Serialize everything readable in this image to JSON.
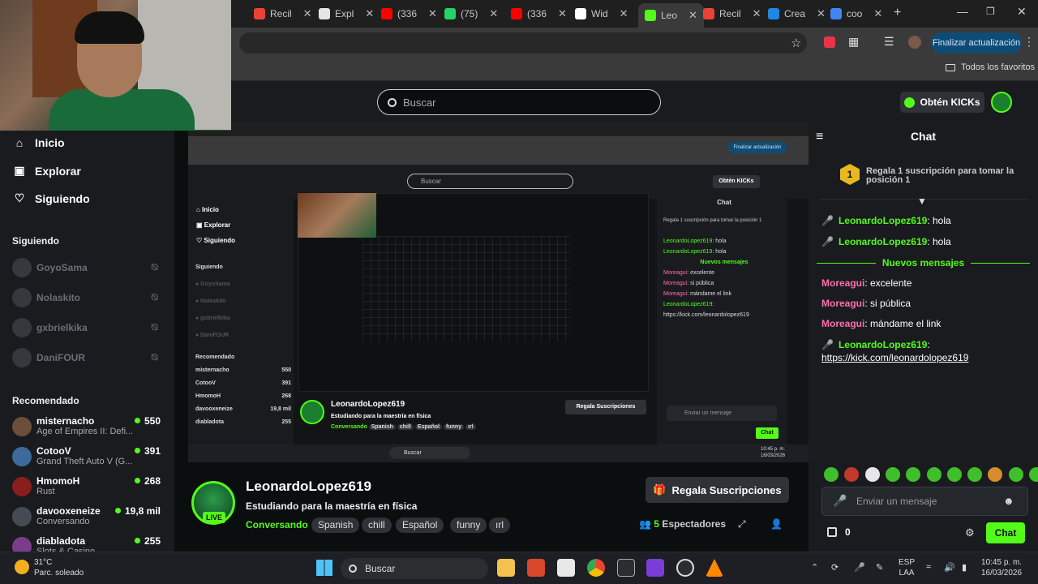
{
  "browser": {
    "tabs": [
      {
        "label": "Recil",
        "color": "#ea4335"
      },
      {
        "label": "Expl",
        "color": "#e5e5e5"
      },
      {
        "label": "(336",
        "color": "#ff0000"
      },
      {
        "label": "(75)",
        "color": "#25d366"
      },
      {
        "label": "(336",
        "color": "#ff0000"
      },
      {
        "label": "Wid",
        "color": "#ffffff"
      },
      {
        "label": "Leo",
        "color": "#53fc18"
      },
      {
        "label": "Recil",
        "color": "#ea4335"
      },
      {
        "label": "Crea",
        "color": "#1e88e5"
      },
      {
        "label": "coo",
        "color": "#4285f4"
      }
    ],
    "update_button": "Finalizar actualización",
    "bookmarks_label": "Todos los favoritos"
  },
  "header": {
    "search_placeholder": "Buscar",
    "get_kicks": "Obtén KICKs"
  },
  "sidebar": {
    "nav": [
      {
        "label": "Inicio",
        "icon": "home-icon"
      },
      {
        "label": "Explorar",
        "icon": "explore-icon"
      },
      {
        "label": "Siguiendo",
        "icon": "heart-icon"
      }
    ],
    "following_title": "Siguiendo",
    "following": [
      {
        "name": "GoyoSama"
      },
      {
        "name": "Nolaskito"
      },
      {
        "name": "gxbrielkika"
      },
      {
        "name": "DaniFOUR"
      }
    ],
    "recommended_title": "Recomendado",
    "recommended": [
      {
        "name": "misternacho",
        "game": "Age of Empires II: Defi...",
        "viewers": "550",
        "color": "#6b4f3a"
      },
      {
        "name": "CotooV",
        "game": "Grand Theft Auto V (G...",
        "viewers": "391",
        "color": "#3d6a9a"
      },
      {
        "name": "HmomoH",
        "game": "Rust",
        "viewers": "268",
        "color": "#8a1d1d"
      },
      {
        "name": "davooxeneize",
        "game": "Conversando",
        "viewers": "19,8 mil",
        "color": "#444b55"
      },
      {
        "name": "diabladota",
        "game": "Slots & Casino",
        "viewers": "255",
        "color": "#7a3d8a"
      }
    ]
  },
  "chat": {
    "title": "Chat",
    "gift_banner": "Regala 1 suscripción para tomar la posición 1",
    "gift_rank": "1",
    "messages_before": [
      {
        "user": "LeonardoLopez619",
        "text": ": hola"
      },
      {
        "user": "LeonardoLopez619",
        "text": ": hola"
      }
    ],
    "new_messages_label": "Nuevos mensajes",
    "messages_after": [
      {
        "user": "Moreagui",
        "text": ": excelente"
      },
      {
        "user": "Moreagui",
        "text": ": si pública"
      },
      {
        "user": "Moreagui",
        "text": ": mándame el link"
      }
    ],
    "link_message": {
      "user": "LeonardoLopez619",
      "text": ":",
      "link": "https://kick.com/leonardolopez619"
    },
    "input_placeholder": "Enviar un mensaje",
    "points": "0",
    "send_label": "Chat"
  },
  "stream": {
    "channel": "LeonardoLopez619",
    "live_label": "LIVE",
    "title": "Estudiando para la maestría en física",
    "category": "Conversando",
    "tags": [
      "Spanish",
      "chill",
      "Español",
      "funny",
      "ırl"
    ],
    "subscribe_label": "Regala Suscripciones",
    "viewers_count": "5",
    "viewers_label": "Espectadores"
  },
  "taskbar": {
    "weather_temp": "31°C",
    "weather_desc": "Parc. soleado",
    "search_label": "Buscar",
    "lang_1": "ESP",
    "lang_2": "LAA",
    "time": "10:45 p. m.",
    "date": "16/03/2026"
  }
}
